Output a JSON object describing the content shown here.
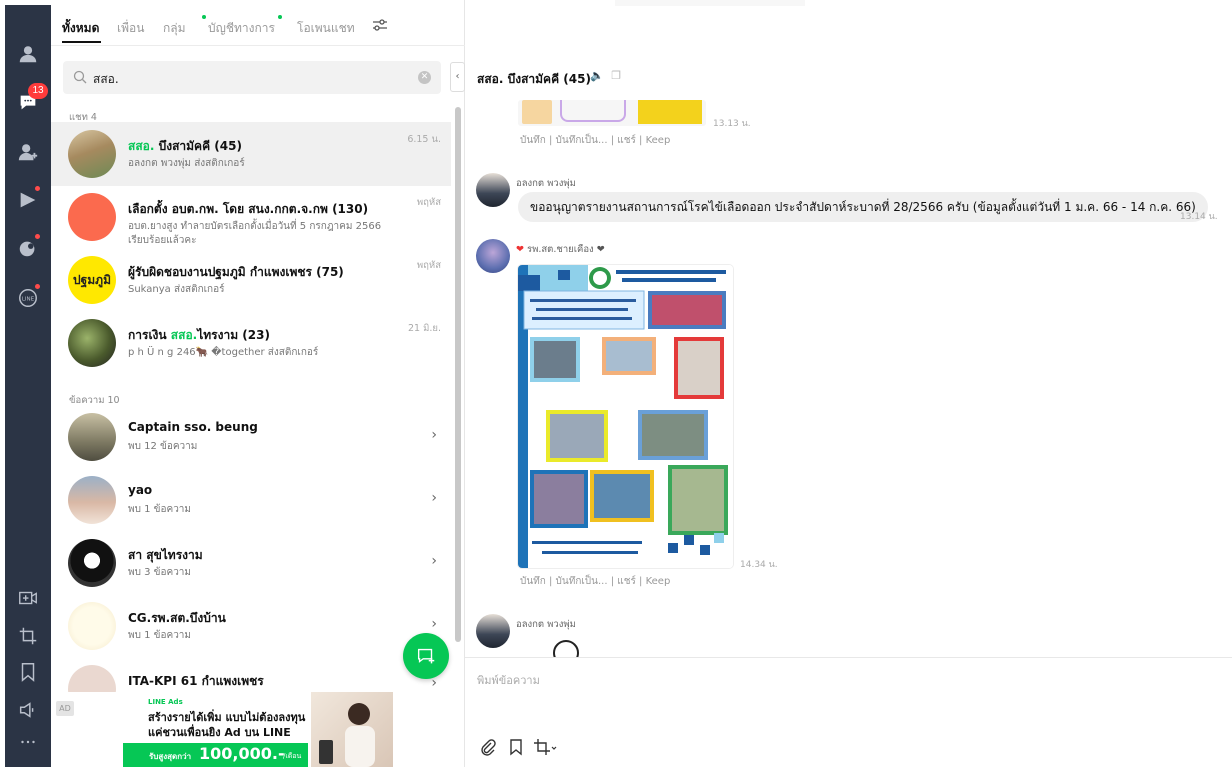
{
  "rail": {
    "badge_count": "13",
    "items": [
      "friends-icon",
      "chats-icon",
      "add-friend-icon",
      "voom-icon",
      "today-icon",
      "line-icon",
      "video-call-icon",
      "crop-icon",
      "keep-icon",
      "announce-icon",
      "more-icon"
    ]
  },
  "tabs": [
    {
      "label": "ทั้งหมด",
      "active": true
    },
    {
      "label": "เพื่อน",
      "active": false
    },
    {
      "label": "กลุ่ม",
      "active": false
    },
    {
      "label": "บัญชีทางการ",
      "active": false
    },
    {
      "label": "โอเพนแชท",
      "active": false
    }
  ],
  "search": {
    "value": "สสอ."
  },
  "sections": {
    "chats": "แชท 4",
    "messages": "ข้อความ 10"
  },
  "chats": [
    {
      "title_hl": "สสอ.",
      "title_rest": " บึงสามัคคี (45)",
      "sub": "อลงกต พวงพุ่ม ส่งสติกเกอร์",
      "time": "6.15 น."
    },
    {
      "title": "เลือกตั้ง อบต.กพ. โดย สนง.กกต.จ.กพ (130)",
      "sub": "อบต.ยางสูง ทำลายบัตรเลือกตั้งเมื่อวันที่ 5 กรกฎาคม 2566",
      "sub2": "เรียบร้อยแล้วคะ",
      "time": "พฤหัส"
    },
    {
      "title": "ผู้รับผิดชอบงานปฐมภูมิ กำแพงเพชร (75)",
      "sub": "Sukanya ส่งสติกเกอร์",
      "time": "พฤหัส",
      "avatar_text": "ปฐมภูมิ"
    },
    {
      "title_pre": "การเงิน ",
      "title_hl": "สสอ.",
      "title_rest": "ไทรงาม (23)",
      "sub": "p h Ü n g 246🐂 �together ส่งสติกเกอร์",
      "time": "21 มิ.ย."
    }
  ],
  "messages": [
    {
      "title": "Captain sso. beung",
      "sub": "พบ 12 ข้อความ"
    },
    {
      "title": "yao",
      "sub": "พบ 1 ข้อความ"
    },
    {
      "title": "สา สุขไทรงาม",
      "sub": "พบ 3 ข้อความ"
    },
    {
      "title": "CG.รพ.สต.บึงบ้าน",
      "sub": "พบ 1 ข้อความ"
    },
    {
      "title": "ITA-KPI 61 กำแพงเพชร",
      "sub": ""
    }
  ],
  "ad": {
    "chip": "AD",
    "brand": "LINE Ads",
    "line1": "สร้างรายได้เพิ่ม แบบไม่ต้องลงทุน",
    "line2": "แค่ชวนเพื่อนยิง Ad บน LINE",
    "small": "รับสูงสุดกว่า",
    "amount": "100,000.-",
    "unit": "/เดือน"
  },
  "chat": {
    "title": "สสอ. บึงสามัคคี (45)",
    "m1_time": "13.13 น.",
    "actions": "บันทึก | บันทึกเป็น... | แชร์ | Keep",
    "m2_sender": "อลงกต พวงพุ่ม",
    "m2_text": "ขออนุญาตรายงานสถานการณ์โรคไข้เลือดออก ประจำสัปดาห์ระบาดที่ 28/2566 ครับ (ข้อมูลตั้งแต่วันที่ 1 ม.ค. 66 - 14 ก.ค. 66)",
    "m2_time": "13.14 น.",
    "m3_sender": "รพ.สต.ชายเคือง",
    "m3_time": "14.34 น.",
    "m4_sender": "อลงกต พวงพุ่ม",
    "input_placeholder": "พิมพ์ข้อความ"
  }
}
